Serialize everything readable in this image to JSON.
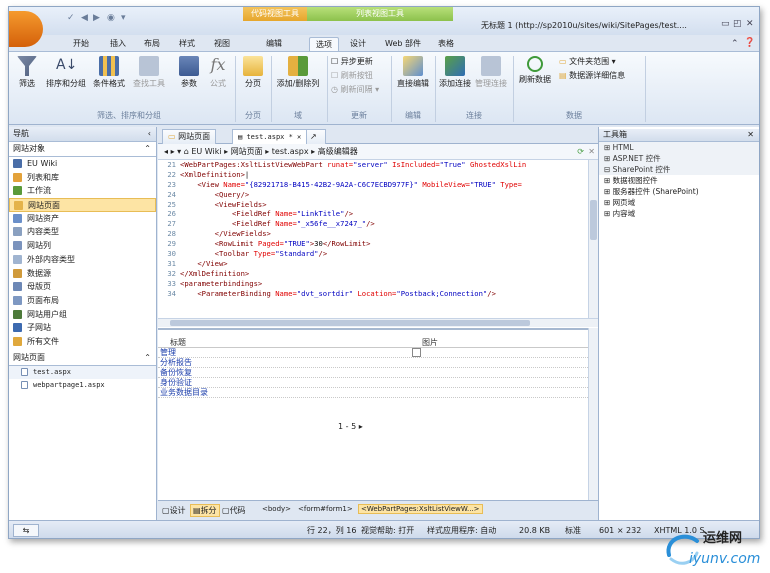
{
  "titlebar": {
    "context_group_1": "代码视图工具",
    "context_group_2": "列表视图工具",
    "document_title": "无标题 1 (http://sp2010u/sites/wiki/SitePages/test...."
  },
  "tabs": [
    {
      "label": "开始",
      "active": false
    },
    {
      "label": "插入",
      "active": false
    },
    {
      "label": "布局",
      "active": false
    },
    {
      "label": "样式",
      "active": false
    },
    {
      "label": "视图",
      "active": false
    },
    {
      "label": "编辑",
      "active": false
    },
    {
      "label": "选项",
      "active": true
    },
    {
      "label": "设计",
      "active": false
    },
    {
      "label": "Web 部件",
      "active": false
    },
    {
      "label": "表格",
      "active": false
    }
  ],
  "ribbon": {
    "filter": "筛选",
    "sort_group": "排序和分组",
    "conditional": "条件格式",
    "find": "查找工具",
    "params": "参数",
    "formula": "公式",
    "paging": "分页",
    "add_remove_columns": "添加/删除列",
    "async_update": "异步更新",
    "refresh_button": "刷新按钮",
    "refresh_interval": "刷新间隔",
    "inline_edit": "直接编辑",
    "add_connection": "添加连接",
    "manage_connections": "管理连接",
    "refresh_data": "刷新数据",
    "folder_scope": "文件夹范围",
    "datasource_details": "数据源详细信息",
    "group_filter_sort": "筛选、排序和分组",
    "group_paging": "分页",
    "group_field": "域",
    "group_update": "更新",
    "group_edit": "编辑",
    "group_connection": "连接",
    "group_data": "数据"
  },
  "nav": {
    "title": "导航",
    "site_objects": "网站对象",
    "items": [
      {
        "label": "EU Wiki",
        "color": "#4a6ea8"
      },
      {
        "label": "列表和库",
        "color": "#e3a23a"
      },
      {
        "label": "工作流",
        "color": "#5a9a3a"
      },
      {
        "label": "网站页面",
        "color": "#e4b34a",
        "selected": true
      },
      {
        "label": "网站资产",
        "color": "#6a8fc9"
      },
      {
        "label": "内容类型",
        "color": "#8aa0c0"
      },
      {
        "label": "网站列",
        "color": "#7b93bd"
      },
      {
        "label": "外部内容类型",
        "color": "#a0b4d0"
      },
      {
        "label": "数据源",
        "color": "#d09a3a"
      },
      {
        "label": "母版页",
        "color": "#6d88b6"
      },
      {
        "label": "页面布局",
        "color": "#7e98c2"
      },
      {
        "label": "网站用户组",
        "color": "#4d7a3a"
      },
      {
        "label": "子网站",
        "color": "#3d6ab0"
      },
      {
        "label": "所有文件",
        "color": "#e0a83c"
      }
    ],
    "pages_section": "网站页面",
    "files": [
      "test.aspx",
      "webpartpage1.aspx"
    ]
  },
  "doctabs": {
    "tab1": "网站页面",
    "tab2": "test.aspx *"
  },
  "breadcrumb": [
    "EU Wiki",
    "网站页面",
    "test.aspx",
    "高级编辑器"
  ],
  "code_lines": [
    {
      "n": "21",
      "parts": [
        [
          "tg",
          "<WebPartPages:XsltListViewWebPart "
        ],
        [
          "at",
          "runat="
        ],
        [
          "av",
          "\"server\" "
        ],
        [
          "at",
          "IsIncluded="
        ],
        [
          "av",
          "\"True\" "
        ],
        [
          "at",
          "GhostedXslLin"
        ]
      ]
    },
    {
      "n": "22",
      "parts": [
        [
          "tg",
          "<XmlDefinition>"
        ],
        [
          "tx",
          "|"
        ]
      ]
    },
    {
      "n": "23",
      "parts": [
        [
          "tx",
          "    "
        ],
        [
          "tg",
          "<View "
        ],
        [
          "at",
          "Name="
        ],
        [
          "av",
          "\"{82921718-B415-42B2-9A2A-C6C7ECBD977F}\" "
        ],
        [
          "at",
          "MobileView="
        ],
        [
          "av",
          "\"TRUE\" "
        ],
        [
          "at",
          "Type="
        ]
      ]
    },
    {
      "n": "24",
      "parts": [
        [
          "tx",
          "        "
        ],
        [
          "tg",
          "<Query/>"
        ]
      ]
    },
    {
      "n": "25",
      "parts": [
        [
          "tx",
          "        "
        ],
        [
          "tg",
          "<ViewFields>"
        ]
      ]
    },
    {
      "n": "26",
      "parts": [
        [
          "tx",
          "            "
        ],
        [
          "tg",
          "<FieldRef "
        ],
        [
          "at",
          "Name="
        ],
        [
          "av",
          "\"LinkTitle\""
        ],
        [
          "tg",
          "/>"
        ]
      ]
    },
    {
      "n": "27",
      "parts": [
        [
          "tx",
          "            "
        ],
        [
          "tg",
          "<FieldRef "
        ],
        [
          "at",
          "Name="
        ],
        [
          "av",
          "\"_x56fe__x7247_\""
        ],
        [
          "tg",
          "/>"
        ]
      ]
    },
    {
      "n": "28",
      "parts": [
        [
          "tx",
          "        "
        ],
        [
          "tg",
          "</ViewFields>"
        ]
      ]
    },
    {
      "n": "29",
      "parts": [
        [
          "tx",
          "        "
        ],
        [
          "tg",
          "<RowLimit "
        ],
        [
          "at",
          "Paged="
        ],
        [
          "av",
          "\"TRUE\""
        ],
        [
          "tg",
          ">"
        ],
        [
          "tx",
          "30"
        ],
        [
          "tg",
          "</RowLimit>"
        ]
      ]
    },
    {
      "n": "30",
      "parts": [
        [
          "tx",
          "        "
        ],
        [
          "tg",
          "<Toolbar "
        ],
        [
          "at",
          "Type="
        ],
        [
          "av",
          "\"Standard\""
        ],
        [
          "tg",
          "/>"
        ]
      ]
    },
    {
      "n": "31",
      "parts": [
        [
          "tx",
          "    "
        ],
        [
          "tg",
          "</View>"
        ]
      ]
    },
    {
      "n": "32",
      "parts": [
        [
          "tg",
          "</XmlDefinition>"
        ]
      ]
    },
    {
      "n": "33",
      "parts": [
        [
          "tg",
          "<parameterbindings>"
        ]
      ]
    },
    {
      "n": "34",
      "parts": [
        [
          "tx",
          "    "
        ],
        [
          "tg",
          "<ParameterBinding "
        ],
        [
          "at",
          "Name="
        ],
        [
          "av",
          "\"dvt_sortdir\" "
        ],
        [
          "at",
          "Location="
        ],
        [
          "av",
          "\"Postback;Connection\""
        ],
        [
          "tg",
          "/>"
        ]
      ]
    }
  ],
  "design": {
    "col_title": "标题",
    "col_image": "图片",
    "rows": [
      "管理",
      "分析报告",
      "备份恢复",
      "身份验证",
      "业务数据目录"
    ],
    "pager": "1 - 5"
  },
  "modebar": {
    "design": "设计",
    "split": "拆分",
    "code": "代码",
    "crumbs": [
      "<body>",
      "<form#form1>",
      "<WebPartPages:XsltListViewW...>"
    ]
  },
  "toolbox": {
    "title": "工具箱",
    "items": [
      {
        "label": "HTML",
        "grey": true
      },
      {
        "label": "ASP.NET 控件",
        "grey": true
      },
      {
        "label": "SharePoint 控件",
        "grey": true,
        "open": true
      },
      {
        "label": "数据视图控件",
        "grey": false,
        "indent": true
      },
      {
        "label": "服务器控件 (SharePoint)",
        "grey": false,
        "indent": true
      },
      {
        "label": "网页域",
        "grey": false,
        "indent": true
      },
      {
        "label": "内容域",
        "grey": false,
        "indent": true
      }
    ]
  },
  "status": {
    "position": "行 22，列 16",
    "help": "视觉帮助: 打开",
    "style": "样式应用程序: 自动",
    "size": "20.8 KB",
    "mode": "标准",
    "dims": "601 × 232",
    "doctype": "XHTML 1.0 S"
  },
  "watermark": {
    "cn": "运维网",
    "url": "iyunv.com"
  }
}
